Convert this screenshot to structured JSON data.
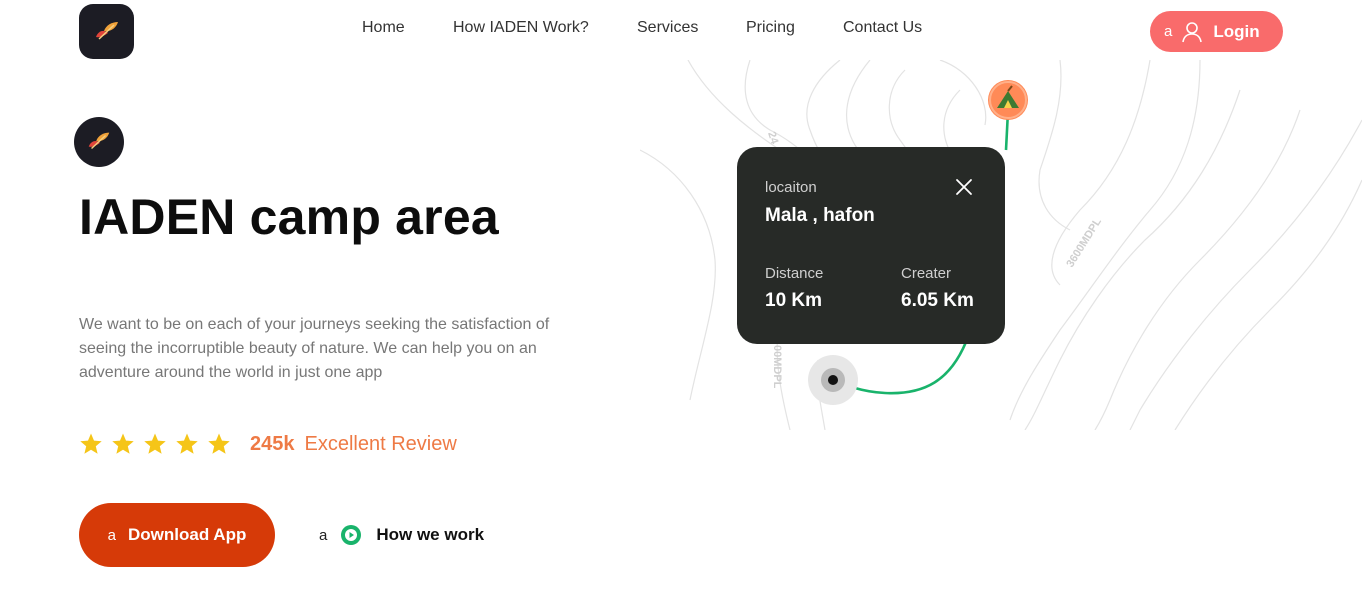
{
  "header": {
    "nav": [
      "Home",
      "How IADEN Work?",
      "Services",
      "Pricing",
      "Contact Us"
    ],
    "login": {
      "prefix": "a",
      "label": "Login"
    }
  },
  "hero": {
    "title": "IADEN camp area",
    "description": "We want to be on each of your journeys seeking the satisfaction of seeing the incorruptible beauty of nature. We can help you on an adventure around the world in just one app",
    "rating": {
      "stars": 5,
      "count": "245k",
      "text": "Excellent Review"
    },
    "download": {
      "prefix": "a",
      "label": "Download App"
    },
    "how_we_work": {
      "prefix": "a",
      "label": "How we work"
    }
  },
  "map": {
    "contour_labels": [
      "3600MDPL",
      "24",
      "00MDPL"
    ],
    "card": {
      "location_label": "locaiton",
      "location_value": "Mala , hafon",
      "distance_label": "Distance",
      "distance_value": "10 Km",
      "creator_label": "Creater",
      "creator_value": "6.05 Km"
    }
  },
  "colors": {
    "accent_coral": "#f96b6b",
    "accent_orange": "#d63a08",
    "review_orange": "#ee7a45",
    "star_yellow": "#f5c518",
    "route_green": "#19b36b",
    "card_dark": "#272a27",
    "logo_dark": "#1c1c24"
  },
  "icons": [
    "logo-leaf-icon",
    "user-icon",
    "star-icon",
    "play-icon",
    "close-icon",
    "tent-pin-icon",
    "start-point-icon"
  ]
}
